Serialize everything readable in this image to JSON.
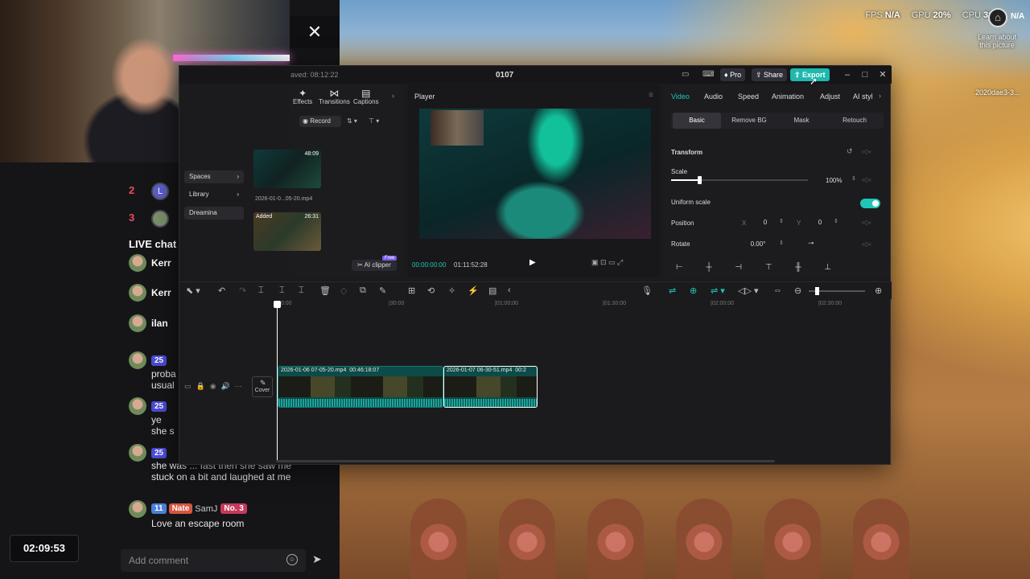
{
  "overlay": {
    "fps_label": "FPS",
    "fps_value": "N/A",
    "gpu_label": "GPU",
    "gpu_value": "20%",
    "cpu_label": "CPU",
    "cpu_value": "31%",
    "other_value": "N/A",
    "learn_about": "Learn about this picture",
    "desktop_file": "2020dae3-3..."
  },
  "stream": {
    "ranks": [
      {
        "rank": "2",
        "initial": "L"
      },
      {
        "rank": "3"
      }
    ],
    "live_chat_title": "LIVE chat",
    "messages": [
      {
        "name": "Kerr"
      },
      {
        "name": "Kerr"
      },
      {
        "name": "ilan"
      },
      {
        "badge": "25",
        "text": "proba usual"
      },
      {
        "badge": "25",
        "text": "ye she s"
      },
      {
        "badge": "25",
        "text": "she was ... fast then she saw me stuck on a bit and laughed at me"
      },
      {
        "badge": "11",
        "badge2": "Nate",
        "name": "SamJ",
        "rank_badge": "No. 3",
        "text": "Love an escape room"
      }
    ],
    "timer": "02:09:53",
    "comment_placeholder": "Add comment",
    "close_glyph": "✕"
  },
  "capcut": {
    "saved_text": "aved: 08:12:22",
    "project_name": "0107",
    "pro_label": "Pro",
    "share_label": "Share",
    "export_label": "Export",
    "tool_tabs": [
      "Effects",
      "Transitions",
      "Captions"
    ],
    "record_label": "Record",
    "sidebar": [
      "Spaces",
      "Library",
      "Dreamina"
    ],
    "media": [
      {
        "duration": "48:09",
        "name": "2026-01-0...05-20.mp4"
      },
      {
        "badge": "Added",
        "duration": "26:31"
      }
    ],
    "ai_clipper": "AI clipper",
    "free_badge": "Free",
    "player": {
      "title": "Player",
      "current_time": "00:00:00:00",
      "total_time": "01:11:52:28"
    },
    "inspector": {
      "tabs": [
        "Video",
        "Audio",
        "Speed",
        "Animation",
        "Adjust",
        "AI styl"
      ],
      "subtabs": [
        "Basic",
        "Remove BG",
        "Mask",
        "Retouch"
      ],
      "transform_label": "Transform",
      "scale_label": "Scale",
      "scale_value": "100%",
      "scale_fraction": 0.2,
      "uniform_label": "Uniform scale",
      "position_label": "Position",
      "pos_x_label": "X",
      "pos_x": "0",
      "pos_y_label": "Y",
      "pos_y": "0",
      "rotate_label": "Rotate",
      "rotate_value": "0.00°"
    },
    "timeline": {
      "ruler": [
        "00:00",
        "|30:00",
        "|01:00:00",
        "|01:30:00",
        "|02:00:00",
        "|02:30:00"
      ],
      "cover_label": "Cover",
      "clips": [
        {
          "name": "2026-01-06 07-05-20.mp4",
          "duration": "00:46:18:07"
        },
        {
          "name": "2026-01-07 06-30-51.mp4",
          "duration": "00:2"
        }
      ]
    }
  },
  "colors": {
    "accent": "#1fc6b8",
    "export": "#1fb8ac",
    "rank": "#e84a5f"
  }
}
